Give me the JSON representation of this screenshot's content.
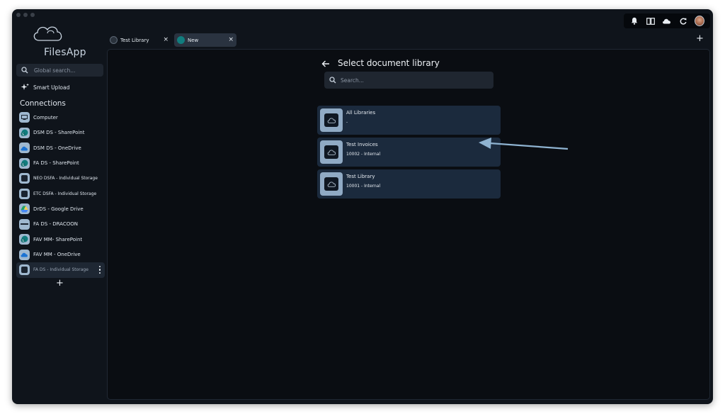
{
  "app": {
    "name": "FilesApp"
  },
  "sidebar": {
    "search_placeholder": "Global search...",
    "smart_upload_label": "Smart Upload",
    "connections_title": "Connections",
    "connections": [
      {
        "label": "Computer",
        "icon": "computer-icon"
      },
      {
        "label": "DSM DS - SharePoint",
        "icon": "sharepoint-icon"
      },
      {
        "label": "DSM DS - OneDrive",
        "icon": "onedrive-icon"
      },
      {
        "label": "FA DS - SharePoint",
        "icon": "sharepoint-icon"
      },
      {
        "label": "NEO DSFA - Individual Storage",
        "icon": "storage-icon"
      },
      {
        "label": "ETC DSFA - Individual Storage",
        "icon": "storage-icon"
      },
      {
        "label": "DrDS - Google Drive",
        "icon": "google-drive-icon"
      },
      {
        "label": "FA DS - DRACOON",
        "icon": "dracoon-icon"
      },
      {
        "label": "FAV MM- SharePoint",
        "icon": "sharepoint-icon"
      },
      {
        "label": "FAV MM - OneDrive",
        "icon": "onedrive-icon"
      },
      {
        "label": "FA DS - Individual Storage",
        "icon": "storage-icon"
      }
    ],
    "add_label": "+"
  },
  "tabs": [
    {
      "label": "Test Library",
      "close": "×"
    },
    {
      "label": "New",
      "close": "×"
    }
  ],
  "new_tab_label": "+",
  "main": {
    "title": "Select document library",
    "search_placeholder": "Search...",
    "libraries": [
      {
        "name": "All Libraries",
        "sub": "-"
      },
      {
        "name": "Test Invoices",
        "sub": "10002 - Internal"
      },
      {
        "name": "Test Library",
        "sub": "10001 - Internal"
      }
    ]
  },
  "colors": {
    "background": "#0f141b",
    "card": "#1b2a3d",
    "card_icon": "#90aac4",
    "annotation_arrow": "#8fb3d1"
  }
}
